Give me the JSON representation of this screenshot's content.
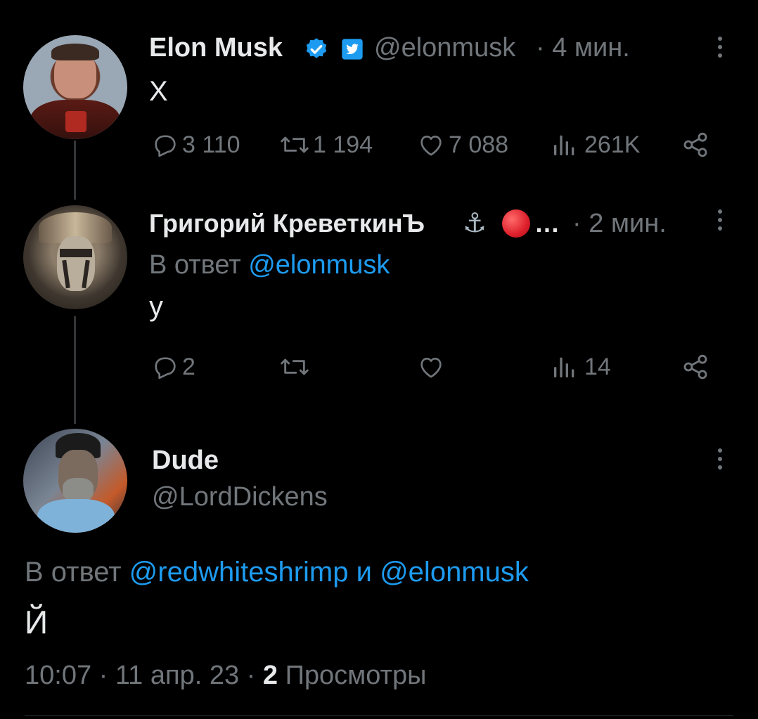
{
  "tweet1": {
    "name": "Elon Musk",
    "handle": "@elonmusk",
    "time": "· 4 мин.",
    "text": "Х",
    "stats": {
      "replies": "3 110",
      "retweets": "1 194",
      "likes": "7 088",
      "views": "261K"
    }
  },
  "tweet2": {
    "name": "Григорий КреветкинЪ",
    "name_emoji": "⚓",
    "ellipsis": "…",
    "time": "· 2 мин.",
    "reply_prefix": "В ответ",
    "reply_to": "@elonmusk",
    "text": "у",
    "stats": {
      "replies": "2",
      "views": "14"
    }
  },
  "tweet3": {
    "name": "Dude",
    "handle": "@LordDickens",
    "reply_prefix": "В ответ",
    "reply_to_1": "@redwhiteshrimp",
    "reply_and": "и",
    "reply_to_2": "@elonmusk",
    "text": "Й",
    "time": "10:07",
    "date": "· 11 апр. 23 ·",
    "views_count": "2",
    "views_label": "Просмотры"
  },
  "colors": {
    "background": "#000000",
    "text": "#e7e9ea",
    "muted": "#71767b",
    "link": "#1d9bf0",
    "verified": "#1d9bf0",
    "red_circle": "#e0245e"
  },
  "icons": [
    "verified-badge-icon",
    "twitter-blue-icon",
    "reply-icon",
    "retweet-icon",
    "like-icon",
    "views-icon",
    "share-icon",
    "more-icon",
    "anchor-icon",
    "red-circle-icon"
  ]
}
